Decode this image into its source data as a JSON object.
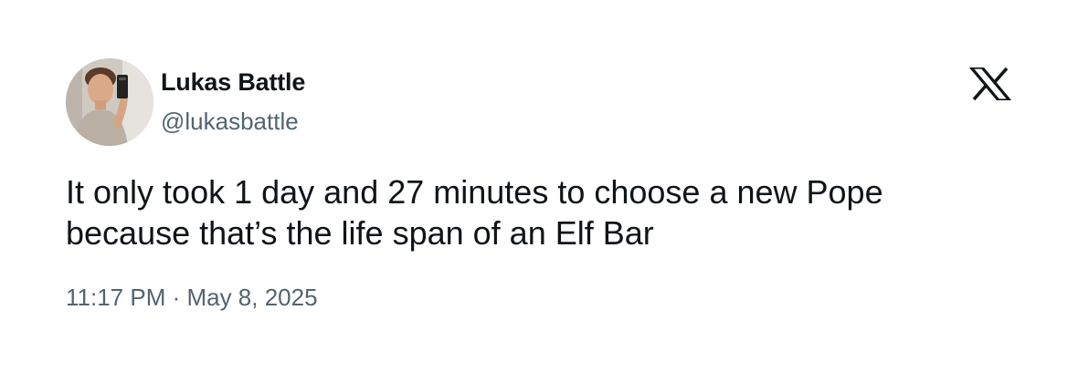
{
  "author": {
    "display_name": "Lukas Battle",
    "handle": "@lukasbattle",
    "avatar_icon": "profile-photo"
  },
  "platform_icon": "x-logo-icon",
  "tweet": {
    "text_lines": [
      "It only took 1 day and 27 minutes to choose a new Pope",
      "because that’s the life span of an Elf Bar"
    ]
  },
  "meta": {
    "time": "11:17 PM",
    "separator": " · ",
    "date": "May 8, 2025"
  },
  "colors": {
    "text_primary": "#0f1419",
    "text_secondary": "#536471",
    "background": "#ffffff"
  }
}
